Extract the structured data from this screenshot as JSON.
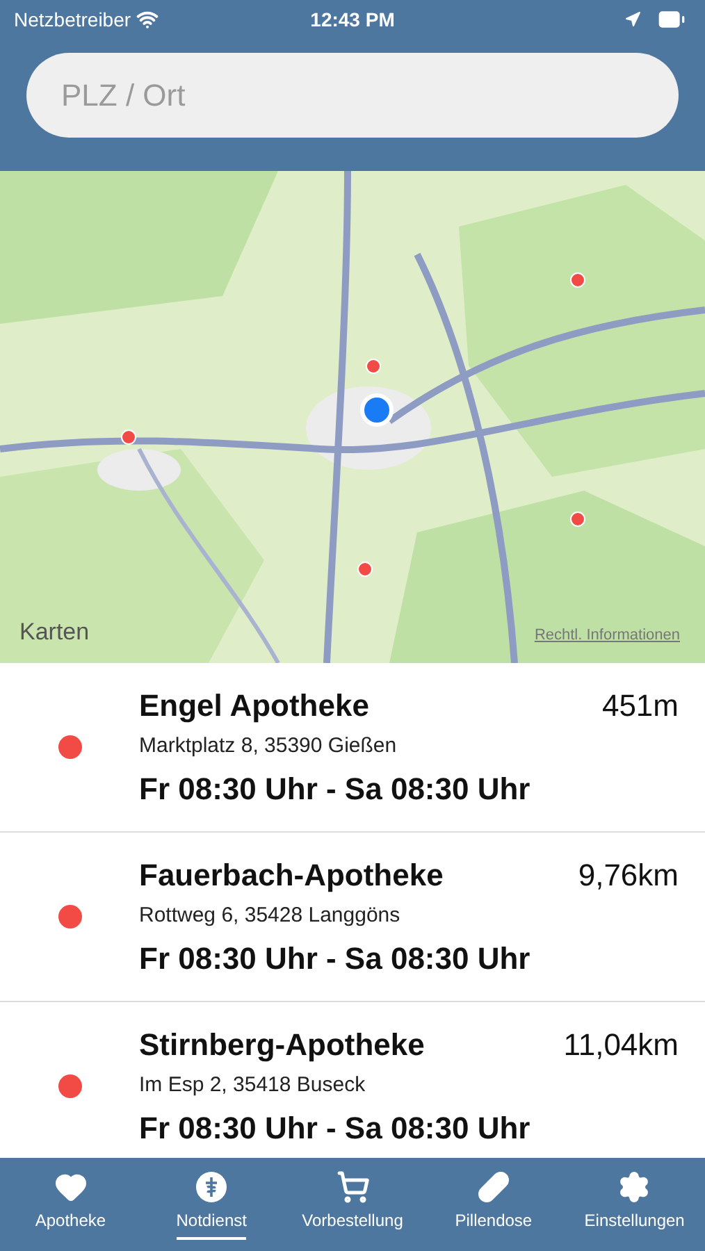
{
  "status_bar": {
    "carrier": "Netzbetreiber",
    "time": "12:43 PM"
  },
  "search": {
    "placeholder": "PLZ / Ort"
  },
  "map": {
    "brand": "Karten",
    "legal_link": "Rechtl. Informationen"
  },
  "pharmacies": [
    {
      "name": "Engel Apotheke",
      "distance": "451m",
      "address": "Marktplatz 8, 35390 Gießen",
      "hours": "Fr 08:30 Uhr - Sa 08:30 Uhr",
      "color": "#f24a45"
    },
    {
      "name": "Fauerbach-Apotheke",
      "distance": "9,76km",
      "address": "Rottweg 6, 35428 Langgöns",
      "hours": "Fr 08:30 Uhr - Sa 08:30 Uhr",
      "color": "#f24a45"
    },
    {
      "name": "Stirnberg-Apotheke",
      "distance": "11,04km",
      "address": "Im Esp 2, 35418 Buseck",
      "hours": "Fr 08:30 Uhr - Sa 08:30 Uhr",
      "color": "#f24a45"
    }
  ],
  "tabs": [
    {
      "kind": "heart",
      "label": "Apotheke",
      "selected": false
    },
    {
      "kind": "emergency",
      "label": "Notdienst",
      "selected": true
    },
    {
      "kind": "cart",
      "label": "Vorbestellung",
      "selected": false
    },
    {
      "kind": "pills",
      "label": "Pillendose",
      "selected": false
    },
    {
      "kind": "gear",
      "label": "Einstellungen",
      "selected": false
    }
  ]
}
